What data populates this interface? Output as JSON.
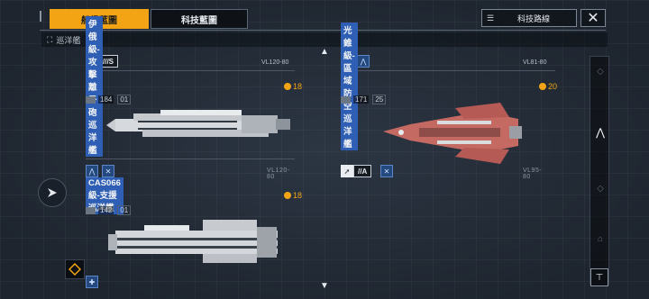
{
  "tabs": {
    "ships": "船艦藍圖",
    "tech": "科技藍圖"
  },
  "route_button": "科技路線",
  "close_label": "✕",
  "filter": {
    "label": "巡洋艦"
  },
  "scroll": {
    "up": "▲",
    "down": "▼"
  },
  "cards": [
    {
      "name": "伊俄級-攻擊離子砲巡洋艦",
      "cost": "18",
      "stat_value": "184",
      "level": "01",
      "code": "VL120-80"
    },
    {
      "name": "光錐級-區域防空巡洋艦",
      "cost": "20",
      "stat_value": "171",
      "level": "25",
      "code": "VL95-80"
    },
    {
      "name": "CAS066級-支援巡洋艦",
      "cost": "18",
      "stat_value": "142",
      "level": "01"
    }
  ],
  "top_partial": {
    "left_rank": "///S",
    "left_code": "VL120-80",
    "right_code": "VL81-80"
  },
  "role_tags": {
    "rank_a": "//A"
  },
  "colors": {
    "accent": "#f2a414",
    "name_bg": "#2f5fb4",
    "hull_red": "#c46a62",
    "hull_white": "#d8dadd"
  },
  "icons": {
    "route": "list-icon",
    "close": "close-icon",
    "nav": "arrow-nav-icon",
    "filter": "filter-icon",
    "badge": "shield-badge-icon"
  }
}
